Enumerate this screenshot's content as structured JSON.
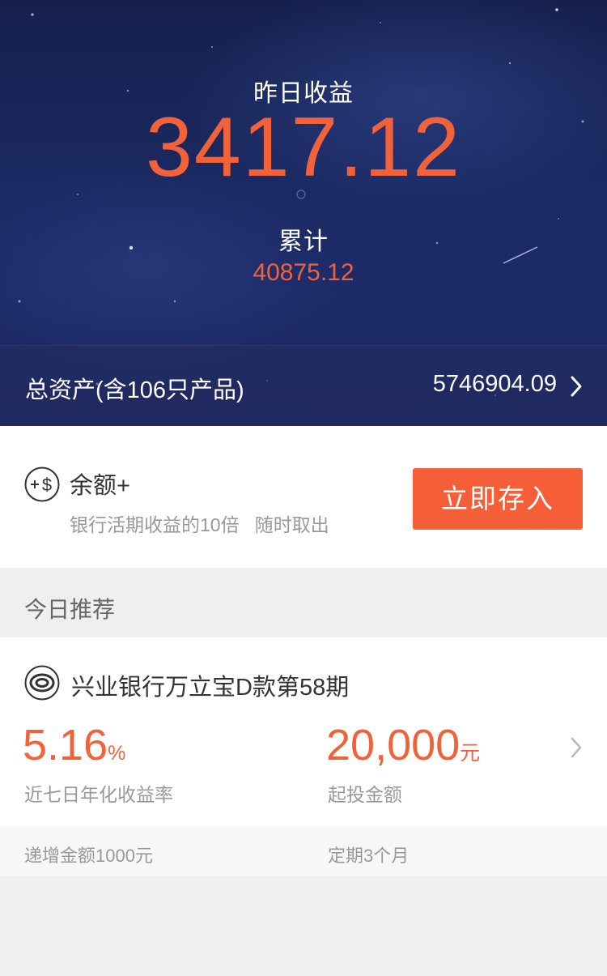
{
  "header": {
    "yesterday_label": "昨日收益",
    "yesterday_value": "3417.12",
    "cumulative_label": "累计",
    "cumulative_value": "40875.12",
    "total_assets_label": "总资产(含106只产品)",
    "total_assets_value": "5746904.09"
  },
  "balance_card": {
    "icon": "plus-dollar-icon",
    "title": "余额+",
    "subtitle": "银行活期收益的10倍   随时取出",
    "button_label": "立即存入"
  },
  "recommend": {
    "section_title": "今日推荐",
    "product": {
      "icon": "bank-logo-icon",
      "name": "兴业银行万立宝D款第58期",
      "rate_value": "5.16",
      "rate_unit": "%",
      "rate_label": "近七日年化收益率",
      "min_value": "20,000",
      "min_unit": "元",
      "min_label": "起投金额",
      "increment_text": "递增金额1000元",
      "term_text": "定期3个月"
    }
  },
  "colors": {
    "accent": "#f2623a",
    "button": "#f45f37",
    "header_bg": "#1b2a63"
  }
}
